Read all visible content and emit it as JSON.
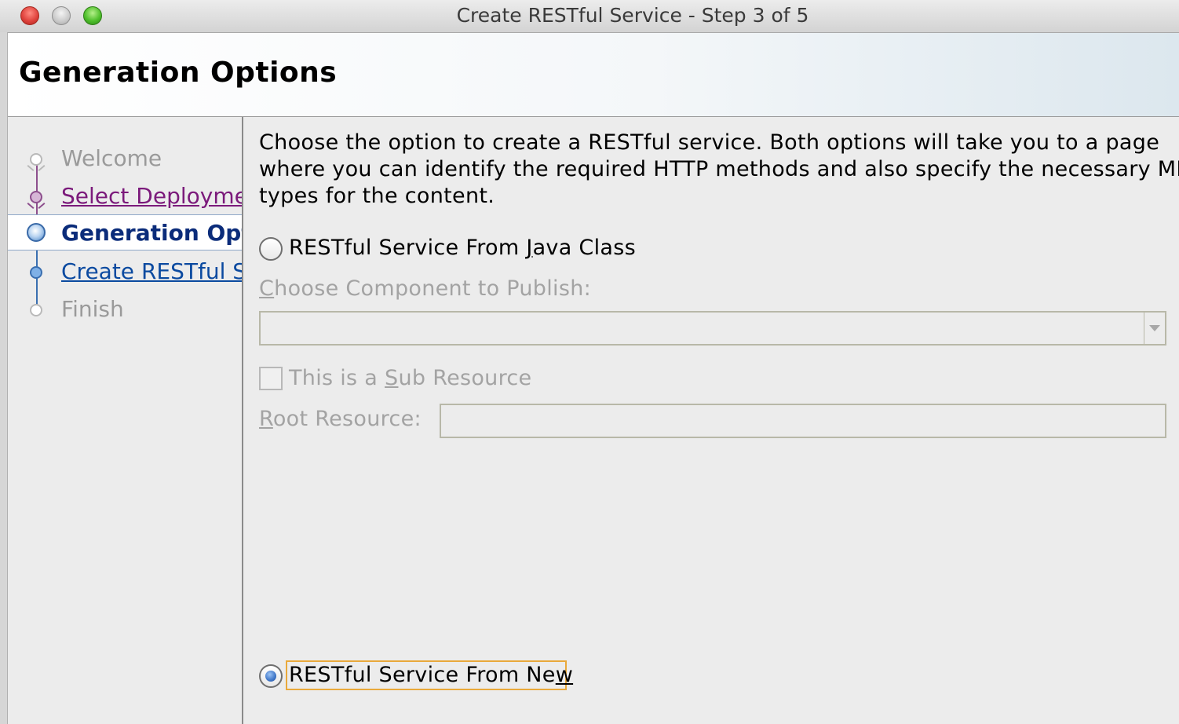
{
  "window": {
    "title": "Create RESTful Service - Step 3 of 5"
  },
  "header": {
    "title": "Generation Options"
  },
  "nav": {
    "items": [
      {
        "label": "Welcome",
        "state": "visited"
      },
      {
        "label": "Select Deployment",
        "state": "link-visited"
      },
      {
        "label": "Generation Options",
        "state": "current"
      },
      {
        "label": "Create RESTful Services",
        "state": "link"
      },
      {
        "label": "Finish",
        "state": "disabled"
      }
    ]
  },
  "content": {
    "description": "Choose the option to create a RESTful service. Both options will take you to a page where you can identify the required HTTP methods and also specify the necessary MIME types for the content.",
    "option_java": {
      "label_pre": "RESTful Service From ",
      "label_mn": "J",
      "label_post": "ava Class",
      "selected": false
    },
    "component": {
      "label_mn": "C",
      "label_rest": "hoose Component to Publish:",
      "value": ""
    },
    "sub_resource": {
      "label_pre": "This is a ",
      "label_mn": "S",
      "label_post": "ub Resource",
      "checked": false
    },
    "root_resource": {
      "label_mn": "R",
      "label_rest": "oot Resource:",
      "value": ""
    },
    "option_new": {
      "label_pre": "RESTful Service From Ne",
      "label_mn": "w",
      "selected": true
    }
  },
  "colors": {
    "nav_current": "#0b2c7a",
    "nav_link": "#0b4aa0",
    "nav_visited_link": "#7b1a7b",
    "disabled_text": "#a3a3a3",
    "focus_ring": "#e9a93b"
  }
}
